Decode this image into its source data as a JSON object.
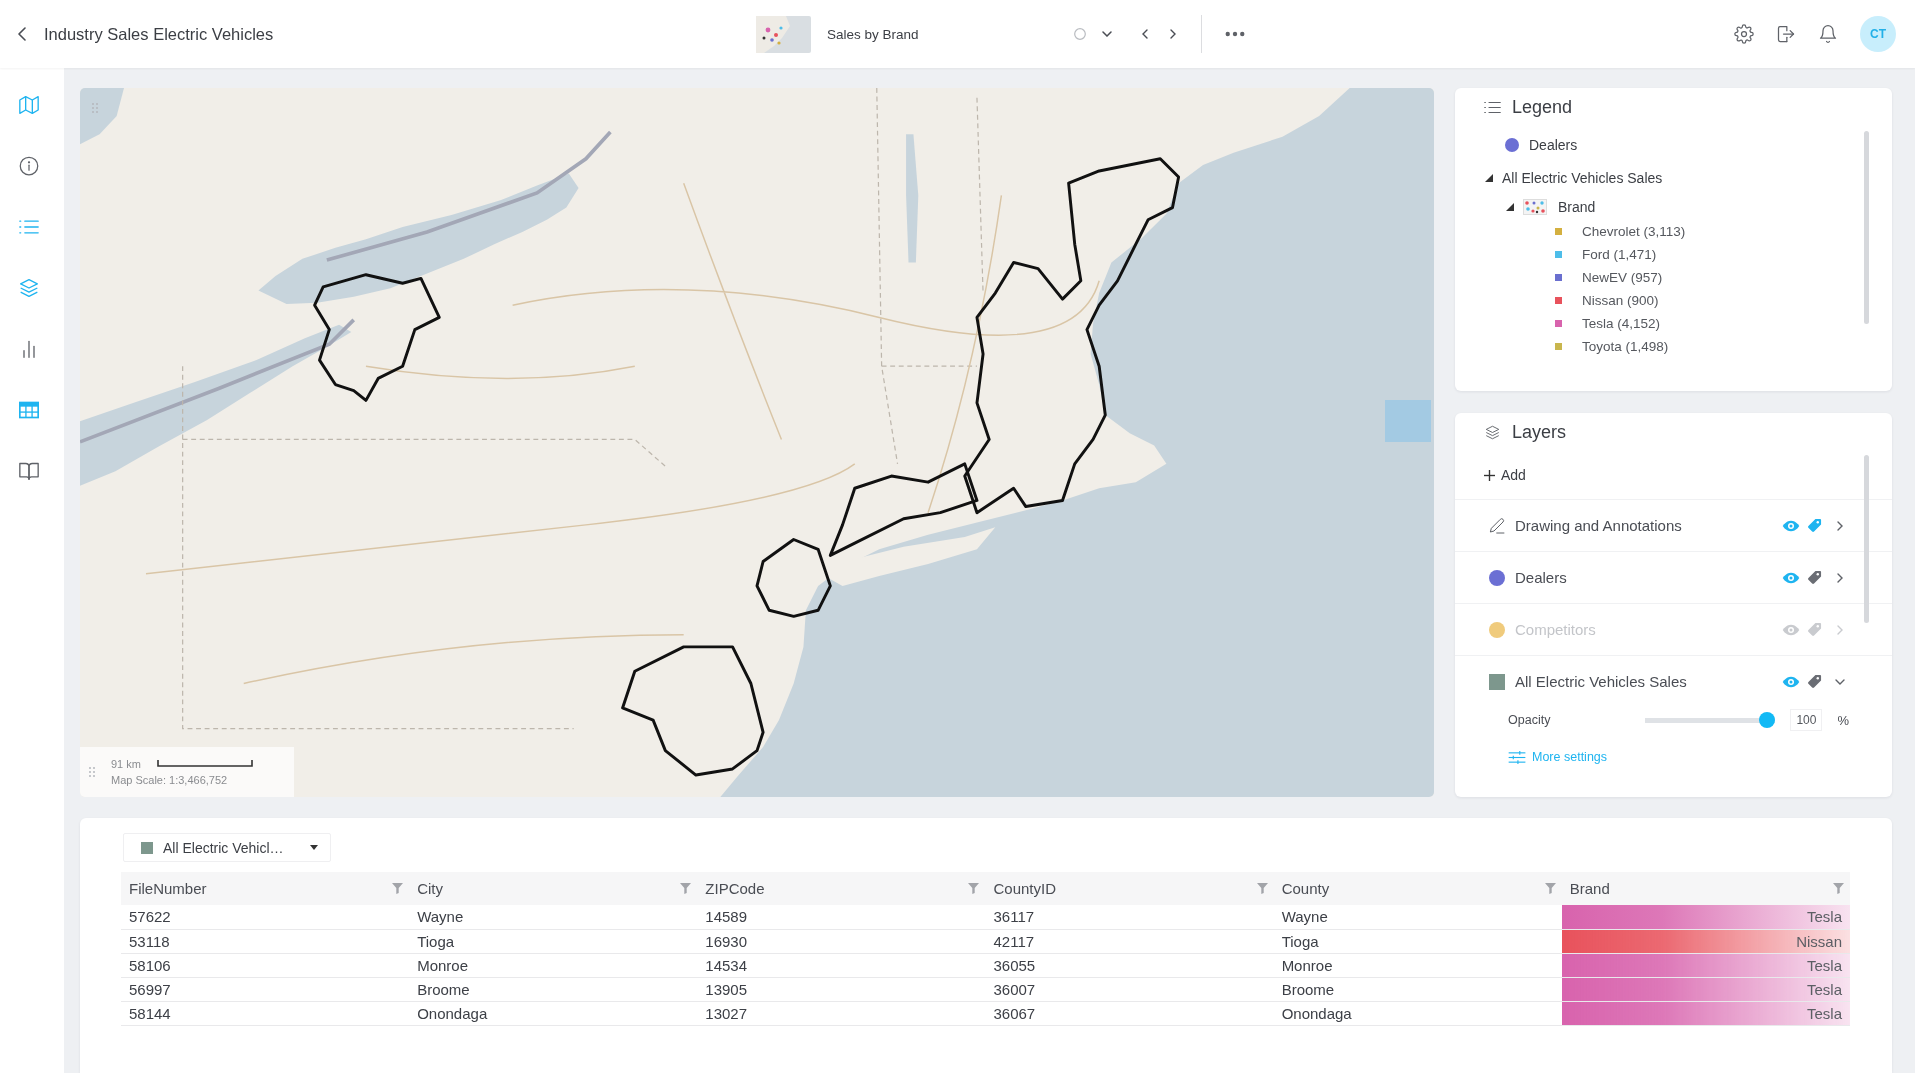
{
  "header": {
    "title": "Industry Sales Electric Vehicles",
    "view_label": "Sales by Brand",
    "user_initials": "CT"
  },
  "sidebar": {
    "items": [
      {
        "kind": "map",
        "selected": true
      },
      {
        "kind": "info",
        "selected": false
      },
      {
        "kind": "legend",
        "selected": true
      },
      {
        "kind": "layers",
        "selected": true
      },
      {
        "kind": "charts",
        "selected": false
      },
      {
        "kind": "table",
        "selected": true
      },
      {
        "kind": "guide",
        "selected": false
      }
    ]
  },
  "map": {
    "scale_distance": "91 km",
    "scale_text": "Map Scale: 1:3,466,752"
  },
  "legend": {
    "title": "Legend",
    "items": [
      {
        "kind": "point",
        "label": "Dealers",
        "color": "#6b6fd4"
      },
      {
        "kind": "group",
        "label": "All Electric Vehicles Sales",
        "expanded": true,
        "children": [
          {
            "kind": "theme",
            "label": "Brand",
            "expanded": true,
            "children": [
              {
                "kind": "swatch",
                "label": "Chevrolet (3,113)",
                "color": "#d4b040"
              },
              {
                "kind": "swatch",
                "label": "Ford (1,471)",
                "color": "#4dbde9"
              },
              {
                "kind": "swatch",
                "label": "NewEV (957)",
                "color": "#6a6fcf"
              },
              {
                "kind": "swatch",
                "label": "Nissan (900)",
                "color": "#e8525c"
              },
              {
                "kind": "swatch",
                "label": "Tesla (4,152)",
                "color": "#d863ad"
              },
              {
                "kind": "swatch",
                "label": "Toyota (1,498)",
                "color": "#c9b64d"
              }
            ]
          }
        ]
      }
    ]
  },
  "layers": {
    "title": "Layers",
    "add_label": "Add",
    "items": [
      {
        "kind": "drawing",
        "name": "Drawing and Annotations",
        "visible": true,
        "labels": true,
        "expanded": false
      },
      {
        "kind": "points",
        "name": "Dealers",
        "color": "#6b6fd4",
        "visible": true,
        "labels": false,
        "expanded": false
      },
      {
        "kind": "points",
        "name": "Competitors",
        "color": "#f0cb7c",
        "visible": false,
        "labels": false,
        "expanded": false
      },
      {
        "kind": "polygons",
        "name": "All Electric Vehicles Sales",
        "color": "#7d978d",
        "visible": true,
        "labels": false,
        "expanded": true,
        "opacity": {
          "label": "Opacity",
          "level": 1,
          "value": "100",
          "unit": "%"
        },
        "more_settings": "More settings"
      }
    ]
  },
  "table": {
    "layer_select": {
      "label": "All Electric Vehicl…",
      "color": "#7d978d"
    },
    "columns": [
      "FileNumber",
      "City",
      "ZIPCode",
      "CountyID",
      "County",
      "Brand"
    ],
    "rows": [
      {
        "cells": [
          "57622",
          "Wayne",
          "14589",
          "36117",
          "Wayne",
          "Tesla"
        ],
        "color": "#d863ad"
      },
      {
        "cells": [
          "53118",
          "Tioga",
          "16930",
          "42117",
          "Tioga",
          "Nissan"
        ],
        "color": "#e8525c"
      },
      {
        "cells": [
          "58106",
          "Monroe",
          "14534",
          "36055",
          "Monroe",
          "Tesla"
        ],
        "color": "#d863ad"
      },
      {
        "cells": [
          "56997",
          "Broome",
          "13905",
          "36007",
          "Broome",
          "Tesla"
        ],
        "color": "#d863ad"
      },
      {
        "cells": [
          "58144",
          "Onondaga",
          "13027",
          "36067",
          "Onondaga",
          "Tesla"
        ],
        "color": "#d863ad"
      }
    ]
  }
}
